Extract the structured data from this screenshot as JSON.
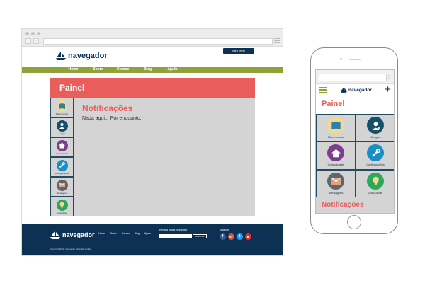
{
  "desktop": {
    "brand_name": "navegador",
    "profile_button": "meu perfil",
    "nav": [
      "Home",
      "Sobre",
      "Cursos",
      "Blog",
      "Ajuda"
    ],
    "panel_title": "Painel",
    "sidebar": [
      {
        "label": "Meus cursos",
        "icon": "book-icon",
        "color": "#f4d98a"
      },
      {
        "label": "Amigos",
        "icon": "user-icon",
        "color": "#14506a"
      },
      {
        "label": "Comunidade",
        "icon": "home-icon",
        "color": "#7a3e8c"
      },
      {
        "label": "Configurações",
        "icon": "wrench-icon",
        "color": "#1a8fc7"
      },
      {
        "label": "Mensagens",
        "icon": "mail-icon",
        "color": "#5d6770"
      },
      {
        "label": "Conquistas",
        "icon": "badge-icon",
        "color": "#2aa85c"
      }
    ],
    "notifications_title": "Notificações",
    "notifications_text": "Nada aqui... Por enquanto.",
    "footer": {
      "brand_name": "navegador",
      "links": [
        "Home",
        "Sobre",
        "Cursos",
        "Blog",
        "Ajuda"
      ],
      "newsletter_label": "Receba nossa newsletter",
      "subscribe_button": "subscribe",
      "social_label": "Siga-nos",
      "social": [
        {
          "glyph": "f",
          "icon": "facebook-icon",
          "color": "#3b5998"
        },
        {
          "glyph": "g+",
          "icon": "googleplus-icon",
          "color": "#dd4b39"
        },
        {
          "glyph": "t",
          "icon": "twitter-icon",
          "color": "#1da1f2"
        },
        {
          "glyph": "▶",
          "icon": "youtube-icon",
          "color": "#e52d27"
        }
      ],
      "copyright": "Copyright 2019 · Navegador Educação Online"
    }
  },
  "mobile": {
    "brand_name": "navegador",
    "panel_title": "Painel",
    "tiles": [
      {
        "label": "Meus cursos",
        "icon": "book-icon",
        "color": "#f4d98a"
      },
      {
        "label": "Amigos",
        "icon": "user-icon",
        "color": "#14506a"
      },
      {
        "label": "Comunidade",
        "icon": "home-icon",
        "color": "#7a3e8c"
      },
      {
        "label": "Configurações",
        "icon": "wrench-icon",
        "color": "#1a8fc7"
      },
      {
        "label": "Mensagens",
        "icon": "mail-icon",
        "color": "#5d6770"
      },
      {
        "label": "Conquistas",
        "icon": "badge-icon",
        "color": "#2aa85c"
      }
    ],
    "notifications_title": "Notificações"
  },
  "colors": {
    "navy": "#0d3152",
    "olive": "#8fa23a",
    "coral": "#e95d5b",
    "panel_gray": "#d4d4d4"
  }
}
